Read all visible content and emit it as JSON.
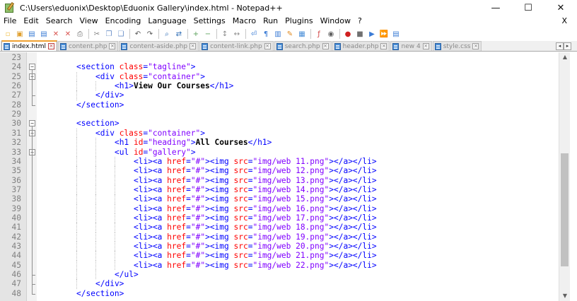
{
  "window": {
    "title": "C:\\Users\\eduonix\\Desktop\\Eduonix Gallery\\index.html - Notepad++",
    "minimize": "—",
    "maximize": "☐",
    "close": "✕"
  },
  "menu": {
    "items": [
      "File",
      "Edit",
      "Search",
      "View",
      "Encoding",
      "Language",
      "Settings",
      "Macro",
      "Run",
      "Plugins",
      "Window",
      "?"
    ],
    "close_doc": "X"
  },
  "toolbar": {
    "icons": [
      "new-file-icon",
      "open-file-icon",
      "save-icon",
      "save-all-icon",
      "close-icon",
      "close-all-icon",
      "print-icon",
      "cut-icon",
      "copy-icon",
      "paste-icon",
      "undo-icon",
      "redo-icon",
      "find-icon",
      "replace-icon",
      "zoom-in-icon",
      "zoom-out-icon",
      "sync-v-icon",
      "sync-h-icon",
      "word-wrap-icon",
      "all-chars-icon",
      "indent-guide-icon",
      "user-lang-icon",
      "doc-map-icon",
      "function-list-icon",
      "monitor-icon",
      "record-macro-icon",
      "stop-record-icon",
      "play-macro-icon",
      "play-multiple-icon",
      "save-macro-icon"
    ]
  },
  "tabs": [
    {
      "label": "index.html",
      "active": true
    },
    {
      "label": "content.php",
      "active": false
    },
    {
      "label": "content-aside.php",
      "active": false
    },
    {
      "label": "content-link.php",
      "active": false
    },
    {
      "label": "search.php",
      "active": false
    },
    {
      "label": "header.php",
      "active": false
    },
    {
      "label": "new 4",
      "active": false
    },
    {
      "label": "style.css",
      "active": false
    }
  ],
  "tab_nav": {
    "left": "◂",
    "right": "▸"
  },
  "editor": {
    "lines": [
      {
        "n": "23",
        "indent": 0,
        "parts": []
      },
      {
        "n": "24",
        "indent": 2,
        "parts": [
          [
            "tag",
            "<section "
          ],
          [
            "attr",
            "class"
          ],
          [
            "tag",
            "="
          ],
          [
            "val",
            "\"tagline\""
          ],
          [
            "tag",
            ">"
          ]
        ]
      },
      {
        "n": "25",
        "indent": 3,
        "parts": [
          [
            "tag",
            "<div "
          ],
          [
            "attr",
            "class"
          ],
          [
            "tag",
            "="
          ],
          [
            "val",
            "\"container\""
          ],
          [
            "tag",
            ">"
          ]
        ]
      },
      {
        "n": "26",
        "indent": 4,
        "parts": [
          [
            "tag",
            "<h1>"
          ],
          [
            "txt",
            "View Our Courses"
          ],
          [
            "tag",
            "</h1>"
          ]
        ]
      },
      {
        "n": "27",
        "indent": 3,
        "parts": [
          [
            "tag",
            "</div>"
          ]
        ]
      },
      {
        "n": "28",
        "indent": 2,
        "parts": [
          [
            "tag",
            "</section>"
          ]
        ]
      },
      {
        "n": "29",
        "indent": 0,
        "parts": []
      },
      {
        "n": "30",
        "indent": 2,
        "parts": [
          [
            "tag",
            "<section>"
          ]
        ]
      },
      {
        "n": "31",
        "indent": 3,
        "parts": [
          [
            "tag",
            "<div "
          ],
          [
            "attr",
            "class"
          ],
          [
            "tag",
            "="
          ],
          [
            "val",
            "\"container\""
          ],
          [
            "tag",
            ">"
          ]
        ]
      },
      {
        "n": "32",
        "indent": 4,
        "parts": [
          [
            "tag",
            "<h1 "
          ],
          [
            "attr",
            "id"
          ],
          [
            "tag",
            "="
          ],
          [
            "val",
            "\"heading\""
          ],
          [
            "tag",
            ">"
          ],
          [
            "txt",
            "All Courses"
          ],
          [
            "tag",
            "</h1>"
          ]
        ]
      },
      {
        "n": "33",
        "indent": 4,
        "parts": [
          [
            "tag",
            "<ul "
          ],
          [
            "attr",
            "id"
          ],
          [
            "tag",
            "="
          ],
          [
            "val",
            "\"gallery\""
          ],
          [
            "tag",
            ">"
          ]
        ]
      },
      {
        "n": "34",
        "indent": 5,
        "parts": [
          [
            "tag",
            "<li><a "
          ],
          [
            "attr",
            "href"
          ],
          [
            "tag",
            "="
          ],
          [
            "val",
            "\"#\""
          ],
          [
            "tag",
            "><img "
          ],
          [
            "attr",
            "src"
          ],
          [
            "tag",
            "="
          ],
          [
            "val",
            "\"img/web 11.png\""
          ],
          [
            "tag",
            "></a></li>"
          ]
        ]
      },
      {
        "n": "35",
        "indent": 5,
        "parts": [
          [
            "tag",
            "<li><a "
          ],
          [
            "attr",
            "href"
          ],
          [
            "tag",
            "="
          ],
          [
            "val",
            "\"#\""
          ],
          [
            "tag",
            "><img "
          ],
          [
            "attr",
            "src"
          ],
          [
            "tag",
            "="
          ],
          [
            "val",
            "\"img/web 12.png\""
          ],
          [
            "tag",
            "></a></li>"
          ]
        ]
      },
      {
        "n": "36",
        "indent": 5,
        "parts": [
          [
            "tag",
            "<li><a "
          ],
          [
            "attr",
            "href"
          ],
          [
            "tag",
            "="
          ],
          [
            "val",
            "\"#\""
          ],
          [
            "tag",
            "><img "
          ],
          [
            "attr",
            "src"
          ],
          [
            "tag",
            "="
          ],
          [
            "val",
            "\"img/web 13.png\""
          ],
          [
            "tag",
            "></a></li>"
          ]
        ]
      },
      {
        "n": "37",
        "indent": 5,
        "parts": [
          [
            "tag",
            "<li><a "
          ],
          [
            "attr",
            "href"
          ],
          [
            "tag",
            "="
          ],
          [
            "val",
            "\"#\""
          ],
          [
            "tag",
            "><img "
          ],
          [
            "attr",
            "src"
          ],
          [
            "tag",
            "="
          ],
          [
            "val",
            "\"img/web 14.png\""
          ],
          [
            "tag",
            "></a></li>"
          ]
        ]
      },
      {
        "n": "38",
        "indent": 5,
        "parts": [
          [
            "tag",
            "<li><a "
          ],
          [
            "attr",
            "href"
          ],
          [
            "tag",
            "="
          ],
          [
            "val",
            "\"#\""
          ],
          [
            "tag",
            "><img "
          ],
          [
            "attr",
            "src"
          ],
          [
            "tag",
            "="
          ],
          [
            "val",
            "\"img/web 15.png\""
          ],
          [
            "tag",
            "></a></li>"
          ]
        ]
      },
      {
        "n": "39",
        "indent": 5,
        "parts": [
          [
            "tag",
            "<li><a "
          ],
          [
            "attr",
            "href"
          ],
          [
            "tag",
            "="
          ],
          [
            "val",
            "\"#\""
          ],
          [
            "tag",
            "><img "
          ],
          [
            "attr",
            "src"
          ],
          [
            "tag",
            "="
          ],
          [
            "val",
            "\"img/web 16.png\""
          ],
          [
            "tag",
            "></a></li>"
          ]
        ]
      },
      {
        "n": "40",
        "indent": 5,
        "parts": [
          [
            "tag",
            "<li><a "
          ],
          [
            "attr",
            "href"
          ],
          [
            "tag",
            "="
          ],
          [
            "val",
            "\"#\""
          ],
          [
            "tag",
            "><img "
          ],
          [
            "attr",
            "src"
          ],
          [
            "tag",
            "="
          ],
          [
            "val",
            "\"img/web 17.png\""
          ],
          [
            "tag",
            "></a></li>"
          ]
        ]
      },
      {
        "n": "41",
        "indent": 5,
        "parts": [
          [
            "tag",
            "<li><a "
          ],
          [
            "attr",
            "href"
          ],
          [
            "tag",
            "="
          ],
          [
            "val",
            "\"#\""
          ],
          [
            "tag",
            "><img "
          ],
          [
            "attr",
            "src"
          ],
          [
            "tag",
            "="
          ],
          [
            "val",
            "\"img/web 18.png\""
          ],
          [
            "tag",
            "></a></li>"
          ]
        ]
      },
      {
        "n": "42",
        "indent": 5,
        "parts": [
          [
            "tag",
            "<li><a "
          ],
          [
            "attr",
            "href"
          ],
          [
            "tag",
            "="
          ],
          [
            "val",
            "\"#\""
          ],
          [
            "tag",
            "><img "
          ],
          [
            "attr",
            "src"
          ],
          [
            "tag",
            "="
          ],
          [
            "val",
            "\"img/web 19.png\""
          ],
          [
            "tag",
            "></a></li>"
          ]
        ]
      },
      {
        "n": "43",
        "indent": 5,
        "parts": [
          [
            "tag",
            "<li><a "
          ],
          [
            "attr",
            "href"
          ],
          [
            "tag",
            "="
          ],
          [
            "val",
            "\"#\""
          ],
          [
            "tag",
            "><img "
          ],
          [
            "attr",
            "src"
          ],
          [
            "tag",
            "="
          ],
          [
            "val",
            "\"img/web 20.png\""
          ],
          [
            "tag",
            "></a></li>"
          ]
        ]
      },
      {
        "n": "44",
        "indent": 5,
        "parts": [
          [
            "tag",
            "<li><a "
          ],
          [
            "attr",
            "href"
          ],
          [
            "tag",
            "="
          ],
          [
            "val",
            "\"#\""
          ],
          [
            "tag",
            "><img "
          ],
          [
            "attr",
            "src"
          ],
          [
            "tag",
            "="
          ],
          [
            "val",
            "\"img/web 21.png\""
          ],
          [
            "tag",
            "></a></li>"
          ]
        ]
      },
      {
        "n": "45",
        "indent": 5,
        "parts": [
          [
            "tag",
            "<li><a "
          ],
          [
            "attr",
            "href"
          ],
          [
            "tag",
            "="
          ],
          [
            "val",
            "\"#\""
          ],
          [
            "tag",
            "><img "
          ],
          [
            "attr",
            "src"
          ],
          [
            "tag",
            "="
          ],
          [
            "val",
            "\"img/web 22.png\""
          ],
          [
            "tag",
            "></a></li>"
          ]
        ]
      },
      {
        "n": "46",
        "indent": 4,
        "parts": [
          [
            "tag",
            "</ul>"
          ]
        ]
      },
      {
        "n": "47",
        "indent": 3,
        "parts": [
          [
            "tag",
            "</div>"
          ]
        ]
      },
      {
        "n": "48",
        "indent": 2,
        "parts": [
          [
            "tag",
            "</section>"
          ]
        ]
      }
    ],
    "fold_marks": {
      "24": "−",
      "25": "−",
      "30": "−",
      "31": "−",
      "33": "−"
    }
  },
  "scrollbar": {
    "up": "▲",
    "down": "▼"
  },
  "colors": {
    "tag": "#0000ff",
    "attr": "#ff0000",
    "value": "#8000ff",
    "text": "#000000",
    "active_tab_accent": "#f0a030"
  }
}
